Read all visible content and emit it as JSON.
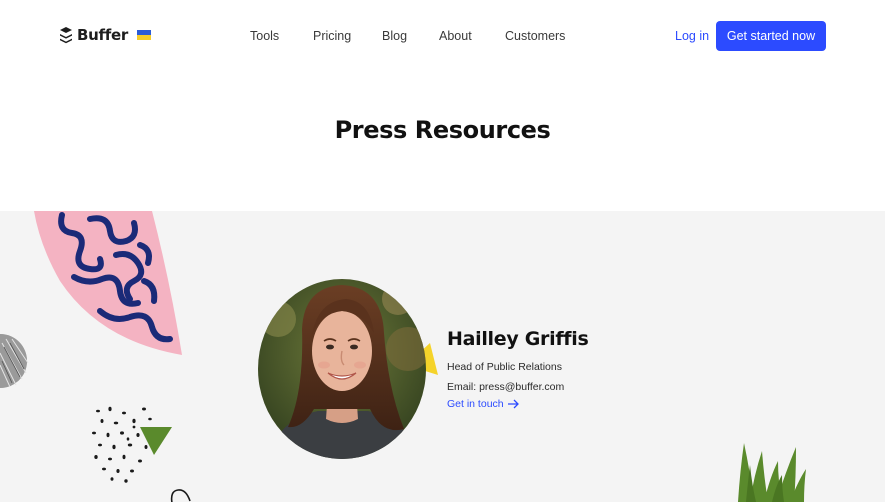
{
  "nav": {
    "brand": "Buffer",
    "links": [
      "Tools",
      "Pricing",
      "Blog",
      "About",
      "Customers"
    ],
    "login": "Log in",
    "cta": "Get started now"
  },
  "page": {
    "title": "Press Resources"
  },
  "contact": {
    "name": "Hailley Griffis",
    "role": "Head of Public Relations",
    "email": "Email: press@buffer.com",
    "link": "Get in touch"
  },
  "colors": {
    "accent": "#2c4bff",
    "section_bg": "#f4f4f4",
    "pink": "#f4b3c2",
    "navy": "#1b2a78",
    "yellow": "#f5d32a",
    "green": "#5a8a2c"
  },
  "icons": {
    "logo": "buffer-logo-icon",
    "flag": "ukraine-flag-icon",
    "arrow": "arrow-right-icon"
  }
}
